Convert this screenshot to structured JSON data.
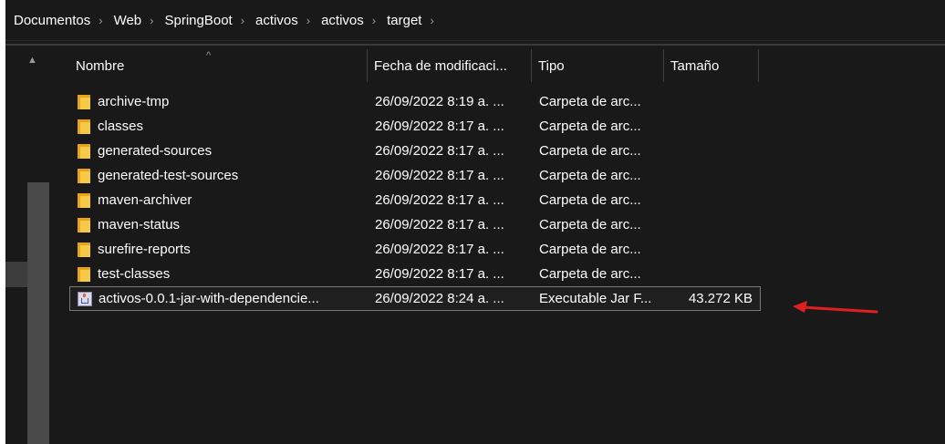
{
  "breadcrumb": [
    {
      "label": "Documentos"
    },
    {
      "label": "Web"
    },
    {
      "label": "SpringBoot"
    },
    {
      "label": "activos"
    },
    {
      "label": "activos"
    },
    {
      "label": "target"
    }
  ],
  "columns": {
    "name": "Nombre",
    "date": "Fecha de modificaci...",
    "type": "Tipo",
    "size": "Tamaño"
  },
  "files": [
    {
      "name": "archive-tmp",
      "date": "26/09/2022 8:19 a. ...",
      "type": "Carpeta de arc...",
      "size": "",
      "icon": "folder-icon"
    },
    {
      "name": "classes",
      "date": "26/09/2022 8:17 a. ...",
      "type": "Carpeta de arc...",
      "size": "",
      "icon": "folder-icon"
    },
    {
      "name": "generated-sources",
      "date": "26/09/2022 8:17 a. ...",
      "type": "Carpeta de arc...",
      "size": "",
      "icon": "folder-icon"
    },
    {
      "name": "generated-test-sources",
      "date": "26/09/2022 8:17 a. ...",
      "type": "Carpeta de arc...",
      "size": "",
      "icon": "folder-icon"
    },
    {
      "name": "maven-archiver",
      "date": "26/09/2022 8:17 a. ...",
      "type": "Carpeta de arc...",
      "size": "",
      "icon": "folder-icon"
    },
    {
      "name": "maven-status",
      "date": "26/09/2022 8:17 a. ...",
      "type": "Carpeta de arc...",
      "size": "",
      "icon": "folder-icon"
    },
    {
      "name": "surefire-reports",
      "date": "26/09/2022 8:17 a. ...",
      "type": "Carpeta de arc...",
      "size": "",
      "icon": "folder-icon"
    },
    {
      "name": "test-classes",
      "date": "26/09/2022 8:17 a. ...",
      "type": "Carpeta de arc...",
      "size": "",
      "icon": "folder-icon"
    },
    {
      "name": "activos-0.0.1-jar-with-dependencie...",
      "date": "26/09/2022 8:24 a. ...",
      "type": "Executable Jar F...",
      "size": "43.272 KB",
      "icon": "java-jar-icon",
      "selected": true
    }
  ],
  "colors": {
    "background": "#191919",
    "folder": "#f7c948",
    "annotation_arrow": "#e02020"
  },
  "icons": {
    "breadcrumb_separator": "chevron-right-icon",
    "sort_indicator": "chevron-up-icon"
  }
}
